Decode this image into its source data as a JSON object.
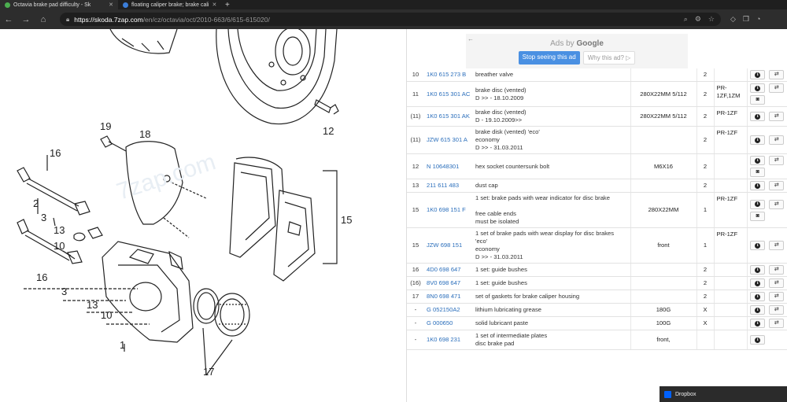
{
  "browser": {
    "tabs": [
      {
        "title": "Octavia brake pad difficulty - Sk",
        "active": true,
        "favicon_color": "#4caf50"
      },
      {
        "title": "floating caliper brake; brake cali",
        "active": false,
        "favicon_color": "#3b7dd8"
      }
    ],
    "url_host": "https://skoda.7zap.com",
    "url_path": "/en/cz/octavia/oct/2010-663/6/615-615020/"
  },
  "diagram": {
    "watermark": "7zap.com",
    "labels": [
      "19",
      "18",
      "16",
      "2",
      "3",
      "13",
      "10",
      "16",
      "3",
      "13",
      "10",
      "1",
      "17",
      "15",
      "12"
    ]
  },
  "ad": {
    "ads_by": "Ads by",
    "brand": "Google",
    "stop_label": "Stop seeing this ad",
    "why_label": "Why this ad? ▷"
  },
  "parts": [
    {
      "num": "10",
      "code": "1K0 615 273 B",
      "desc": [
        "breather valve"
      ],
      "spec": "",
      "qty": "2",
      "note": "",
      "actions": [
        "info",
        "swap"
      ]
    },
    {
      "num": "11",
      "code": "1K0 615 301 AC",
      "desc": [
        "brake disc (vented)",
        "D >> - 18.10.2009"
      ],
      "spec": "280X22MM 5/112",
      "qty": "2",
      "note": "PR-1ZF,1ZM",
      "actions": [
        "info",
        "swap",
        "camera"
      ]
    },
    {
      "num": "(11)",
      "code": "1K0 615 301 AK",
      "desc": [
        "brake disc (vented)",
        "D - 19.10.2009>>"
      ],
      "spec": "280X22MM 5/112",
      "qty": "2",
      "note": "PR-1ZF",
      "actions": [
        "info",
        "swap"
      ]
    },
    {
      "num": "(11)",
      "code": "JZW 615 301 A",
      "desc": [
        "brake disk (vented) 'eco'",
        "economy",
        "D >> - 31.03.2011"
      ],
      "spec": "",
      "qty": "2",
      "note": "PR-1ZF",
      "actions": [
        "info",
        "swap"
      ]
    },
    {
      "num": "12",
      "code": "N  10648301",
      "desc": [
        "hex socket countersunk bolt"
      ],
      "spec": "M6X16",
      "qty": "2",
      "note": "",
      "actions": [
        "info",
        "swap",
        "camera"
      ]
    },
    {
      "num": "13",
      "code": "211 611 483",
      "desc": [
        "dust cap"
      ],
      "spec": "",
      "qty": "2",
      "note": "",
      "actions": [
        "info",
        "swap"
      ]
    },
    {
      "num": "15",
      "code": "1K0 698 151 F",
      "desc": [
        "1 set: brake pads with wear indicator for disc brake",
        "",
        "free cable ends",
        "must be isolated"
      ],
      "spec": "280X22MM",
      "qty": "1",
      "note": "PR-1ZF",
      "actions": [
        "info",
        "swap",
        "camera"
      ]
    },
    {
      "num": "15",
      "code": "JZW 698 151",
      "desc": [
        "1 set of brake pads with wear display for disc brakes",
        "'eco'",
        "economy",
        "D >> - 31.03.2011"
      ],
      "spec": "front",
      "qty": "1",
      "note": "PR-1ZF",
      "actions": [
        "info",
        "swap"
      ]
    },
    {
      "num": "16",
      "code": "4D0 698 647",
      "desc": [
        "1 set: guide bushes"
      ],
      "spec": "",
      "qty": "2",
      "note": "",
      "actions": [
        "info",
        "swap"
      ]
    },
    {
      "num": "(16)",
      "code": "8V0 698 647",
      "desc": [
        "1 set: guide bushes"
      ],
      "spec": "",
      "qty": "2",
      "note": "",
      "actions": [
        "info",
        "swap"
      ]
    },
    {
      "num": "17",
      "code": "8N0 698 471",
      "desc": [
        "set of gaskets for brake caliper housing"
      ],
      "spec": "",
      "qty": "2",
      "note": "",
      "actions": [
        "info",
        "swap"
      ]
    },
    {
      "num": "-",
      "code": "G  052150A2",
      "desc": [
        "lithium lubricating grease"
      ],
      "spec": "180G",
      "qty": "X",
      "note": "",
      "actions": [
        "info",
        "swap"
      ]
    },
    {
      "num": "-",
      "code": "G  000650",
      "desc": [
        "solid lubricant paste"
      ],
      "spec": "100G",
      "qty": "X",
      "note": "",
      "actions": [
        "info",
        "swap"
      ]
    },
    {
      "num": "-",
      "code": "1K0 698 231",
      "desc": [
        "1 set of intermediate plates",
        "disc brake pad"
      ],
      "spec": "front,",
      "qty": "",
      "note": "",
      "actions": [
        "info"
      ]
    }
  ],
  "toast": {
    "label": "Dropbox"
  },
  "icons": {
    "info": "info-icon",
    "swap": "swap-arrows-icon",
    "camera": "camera-icon"
  }
}
